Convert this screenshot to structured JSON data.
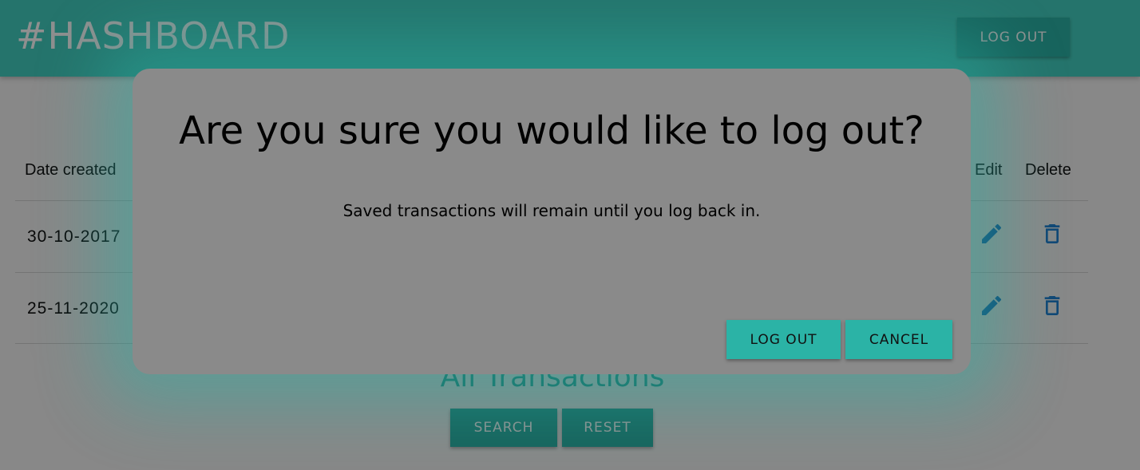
{
  "header": {
    "brand": "#HASHBOARD",
    "logout_label": "LOG OUT"
  },
  "table": {
    "columns": {
      "date_created": "Date created",
      "edit": "Edit",
      "delete": "Delete"
    },
    "rows": [
      {
        "date": "30-10-2017"
      },
      {
        "date": "25-11-2020"
      }
    ]
  },
  "transactions": {
    "title": "All Transactions",
    "search_label": "SEARCH",
    "reset_label": "RESET"
  },
  "modal": {
    "title": "Are you sure you would like to log out?",
    "message": "Saved transactions will remain until you log back in.",
    "logout_label": "LOG OUT",
    "cancel_label": "CANCEL"
  },
  "colors": {
    "accent": "#2bb3a6",
    "header": "#43cfc0",
    "icon": "#1f7fd1"
  },
  "icons": {
    "edit": "pencil-icon",
    "delete": "trash-icon"
  }
}
